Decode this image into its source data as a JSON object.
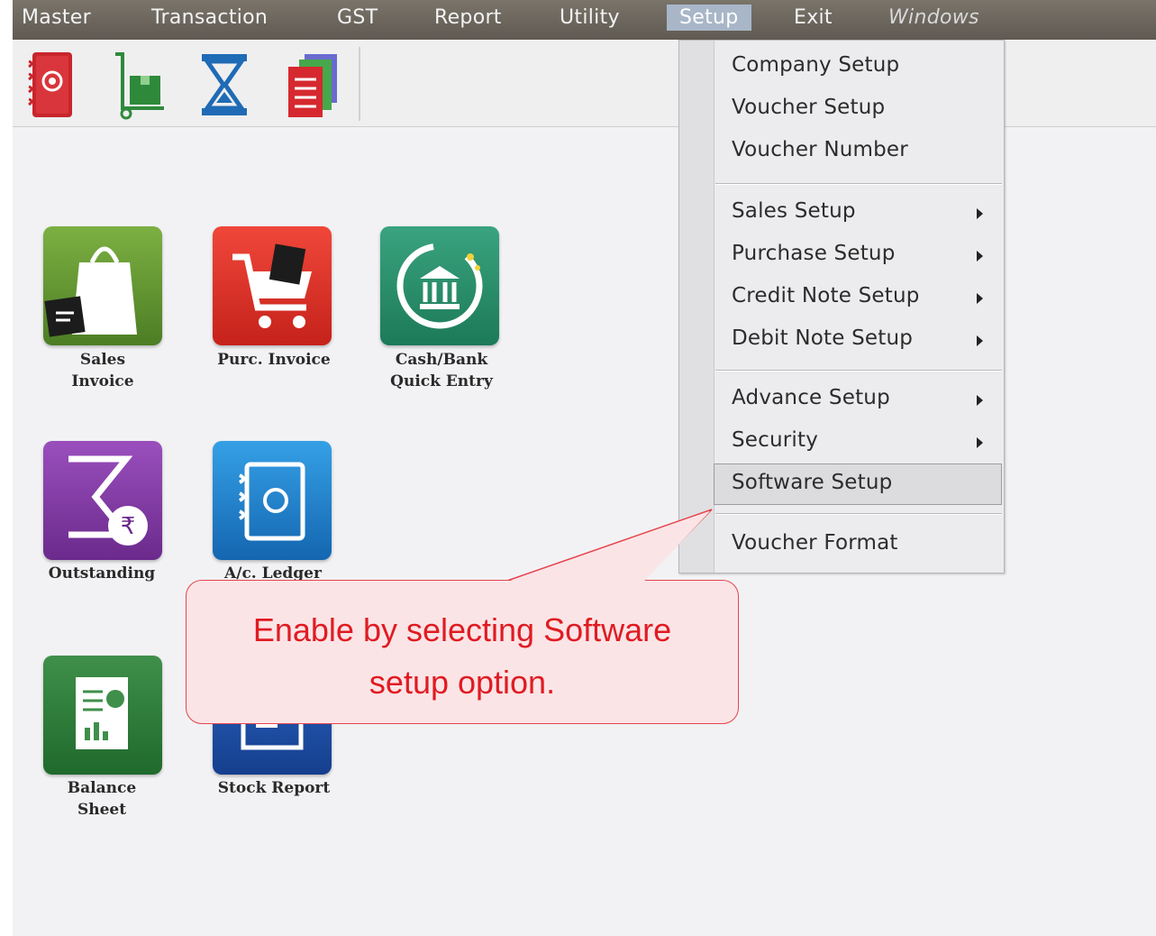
{
  "menubar": {
    "items": [
      {
        "label": "Master"
      },
      {
        "label": "Transaction"
      },
      {
        "label": "GST"
      },
      {
        "label": "Report"
      },
      {
        "label": "Utility"
      },
      {
        "label": "Setup",
        "active": true
      },
      {
        "label": "Exit"
      },
      {
        "label": "Windows"
      }
    ]
  },
  "toolbar": {
    "icons": [
      "address-book-icon",
      "stock-transfer-icon",
      "hourglass-icon",
      "documents-icon"
    ]
  },
  "tiles": [
    {
      "label": "Sales\nInvoice",
      "icon": "shopping-bag-icon",
      "color": "#5a8a2c"
    },
    {
      "label": "Purc. Invoice",
      "icon": "shopping-cart-icon",
      "color": "#e03a2e"
    },
    {
      "label": "Cash/Bank\nQuick Entry",
      "icon": "bank-icon",
      "color": "#2b8a6a"
    },
    {
      "label": "Outstanding",
      "icon": "outstanding-icon",
      "color": "#7a3a98"
    },
    {
      "label": "A/c. Ledger",
      "icon": "ledger-icon",
      "color": "#1f7dc8"
    },
    {
      "label": "Balance\nSheet",
      "icon": "balance-sheet-icon",
      "color": "#2f7a3a"
    },
    {
      "label": "Stock Report",
      "icon": "stock-report-icon",
      "color": "#1f4fa0"
    }
  ],
  "setup_menu": {
    "items": [
      {
        "label": "Company Setup",
        "submenu": false
      },
      {
        "label": "Voucher Setup",
        "submenu": false
      },
      {
        "label": "Voucher Number",
        "submenu": false
      },
      {
        "label": "Sales Setup",
        "submenu": true
      },
      {
        "label": "Purchase Setup",
        "submenu": true
      },
      {
        "label": "Credit Note Setup",
        "submenu": true
      },
      {
        "label": "Debit Note Setup",
        "submenu": true
      },
      {
        "label": "Advance Setup",
        "submenu": true
      },
      {
        "label": "Security",
        "submenu": true
      },
      {
        "label": "Software Setup",
        "submenu": false,
        "highlighted": true
      },
      {
        "label": "Voucher Format",
        "submenu": false
      }
    ]
  },
  "callout": {
    "text_line1": "Enable by selecting Software",
    "text_line2": "setup option."
  }
}
